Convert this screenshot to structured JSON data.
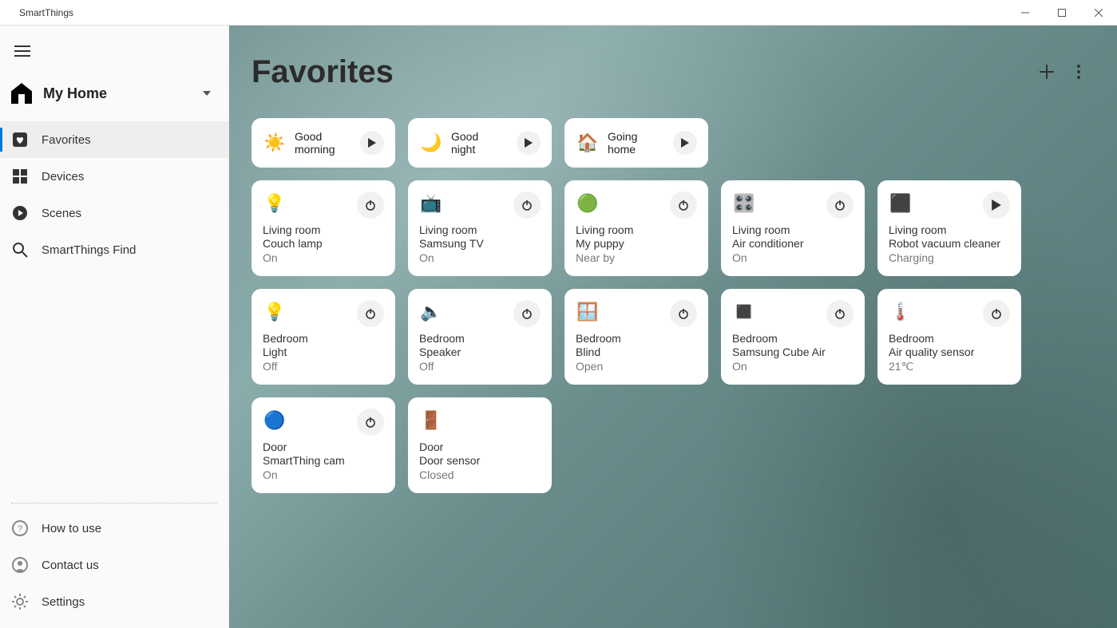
{
  "window": {
    "title": "SmartThings"
  },
  "sidebar": {
    "location": "My Home",
    "nav": [
      {
        "label": "Favorites"
      },
      {
        "label": "Devices"
      },
      {
        "label": "Scenes"
      },
      {
        "label": "SmartThings Find"
      }
    ],
    "footer": [
      {
        "label": "How to use"
      },
      {
        "label": "Contact us"
      },
      {
        "label": "Settings"
      }
    ]
  },
  "main": {
    "title": "Favorites",
    "scenes": [
      {
        "label": "Good\nmorning",
        "icon": "☀️"
      },
      {
        "label": "Good\nnight",
        "icon": "🌙"
      },
      {
        "label": "Going\nhome",
        "icon": "🏠"
      }
    ],
    "devices": [
      {
        "room": "Living room",
        "name": "Couch lamp",
        "status": "On",
        "icon": "💡",
        "action": "power"
      },
      {
        "room": "Living room",
        "name": "Samsung TV",
        "status": "On",
        "icon": "📺",
        "action": "power"
      },
      {
        "room": "Living room",
        "name": "My puppy",
        "status": "Near by",
        "icon": "🟢",
        "action": "power"
      },
      {
        "room": "Living room",
        "name": "Air conditioner",
        "status": "On",
        "icon": "🎛️",
        "action": "power"
      },
      {
        "room": "Living room",
        "name": "Robot vacuum cleaner",
        "status": "Charging",
        "icon": "⬛",
        "action": "play"
      },
      {
        "room": "Bedroom",
        "name": "Light",
        "status": "Off",
        "icon": "💡",
        "action": "power"
      },
      {
        "room": "Bedroom",
        "name": "Speaker",
        "status": "Off",
        "icon": "🔈",
        "action": "power"
      },
      {
        "room": "Bedroom",
        "name": "Blind",
        "status": "Open",
        "icon": "🪟",
        "action": "power"
      },
      {
        "room": "Bedroom",
        "name": "Samsung Cube Air",
        "status": "On",
        "icon": "◼️",
        "action": "power"
      },
      {
        "room": "Bedroom",
        "name": "Air quality sensor",
        "status": "21℃",
        "icon": "🌡️",
        "action": "power"
      },
      {
        "room": "Door",
        "name": "SmartThing cam",
        "status": "On",
        "icon": "🔵",
        "action": "power"
      },
      {
        "room": "Door",
        "name": "Door sensor",
        "status": "Closed",
        "icon": "🚪",
        "action": "none"
      }
    ]
  }
}
